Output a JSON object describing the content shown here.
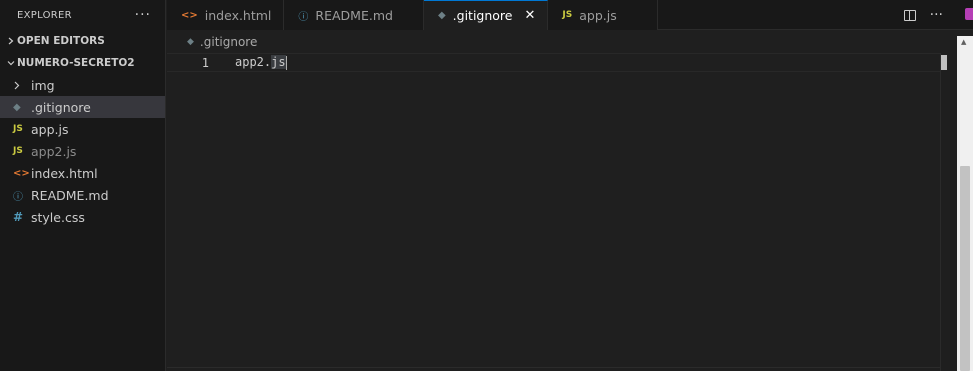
{
  "explorer": {
    "title": "EXPLORER",
    "more_label": "···",
    "open_editors_label": "OPEN EDITORS",
    "folder_label": "NUMERO-SECRETO2",
    "items": [
      {
        "label": "img",
        "icon": "chevron-right-icon"
      },
      {
        "label": ".gitignore",
        "icon": "git-icon"
      },
      {
        "label": "app.js",
        "icon": "js-icon"
      },
      {
        "label": "app2.js",
        "icon": "js-icon"
      },
      {
        "label": "index.html",
        "icon": "html-icon"
      },
      {
        "label": "README.md",
        "icon": "info-icon"
      },
      {
        "label": "style.css",
        "icon": "hash-icon"
      }
    ]
  },
  "tabs": [
    {
      "label": "index.html",
      "icon": "html-icon"
    },
    {
      "label": "README.md",
      "icon": "info-icon"
    },
    {
      "label": ".gitignore",
      "icon": "git-icon",
      "active": true
    },
    {
      "label": "app.js",
      "icon": "js-icon"
    }
  ],
  "icons": {
    "js": "JS",
    "html": "<>",
    "info": "ⓘ",
    "hash": "#",
    "git": "◆",
    "chevron_right": "›",
    "chevron_down": "⌄",
    "close": "✕",
    "more": "···"
  },
  "breadcrumb": {
    "label": ".gitignore"
  },
  "editor": {
    "lines": [
      {
        "number": "1",
        "text_before": "app2.",
        "text_highlight": "js"
      }
    ]
  },
  "colors": {
    "accent": "#0078d4",
    "js": "#cbcb41",
    "html": "#e37933",
    "info": "#519aba"
  }
}
